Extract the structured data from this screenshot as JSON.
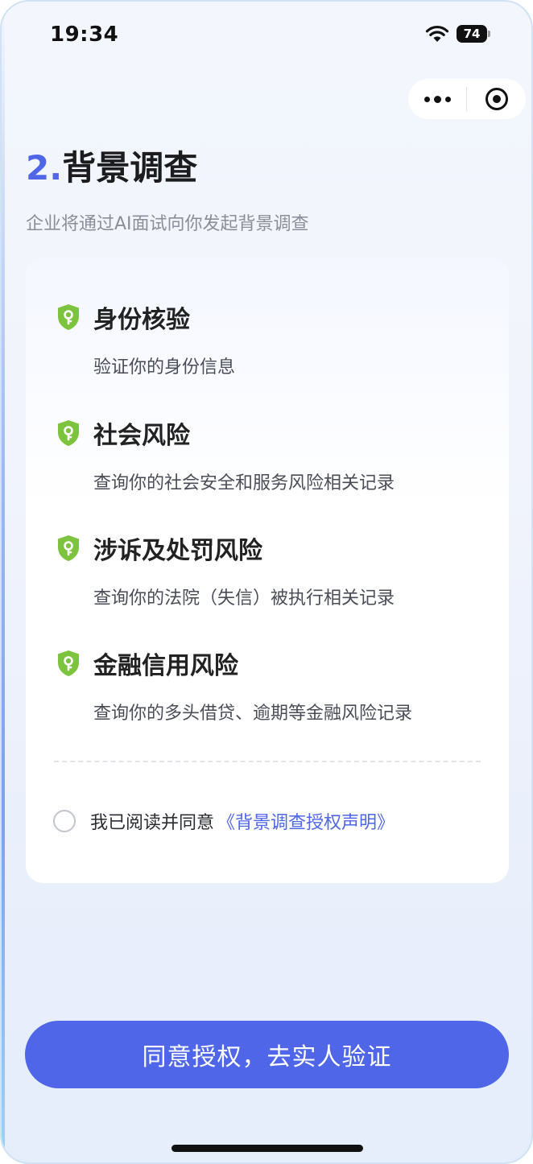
{
  "status": {
    "time": "19:34",
    "battery": "74"
  },
  "header": {
    "number": "2.",
    "title": "背景调查",
    "subtitle": "企业将通过AI面试向你发起背景调查"
  },
  "items": [
    {
      "title": "身份核验",
      "desc": "验证你的身份信息"
    },
    {
      "title": "社会风险",
      "desc": "查询你的社会安全和服务风险相关记录"
    },
    {
      "title": "涉诉及处罚风险",
      "desc": "查询你的法院（失信）被执行相关记录"
    },
    {
      "title": "金融信用风险",
      "desc": "查询你的多头借贷、逾期等金融风险记录"
    }
  ],
  "agreement": {
    "text": "我已阅读并同意",
    "link": "《背景调查授权声明》"
  },
  "cta": {
    "label": "同意授权，去实人验证"
  },
  "colors": {
    "accent": "#4f66e8",
    "shield": "#7cc43d"
  },
  "icons": {
    "item": "shield-key-icon",
    "more": "more-dots-icon",
    "close": "target-circle-icon"
  }
}
